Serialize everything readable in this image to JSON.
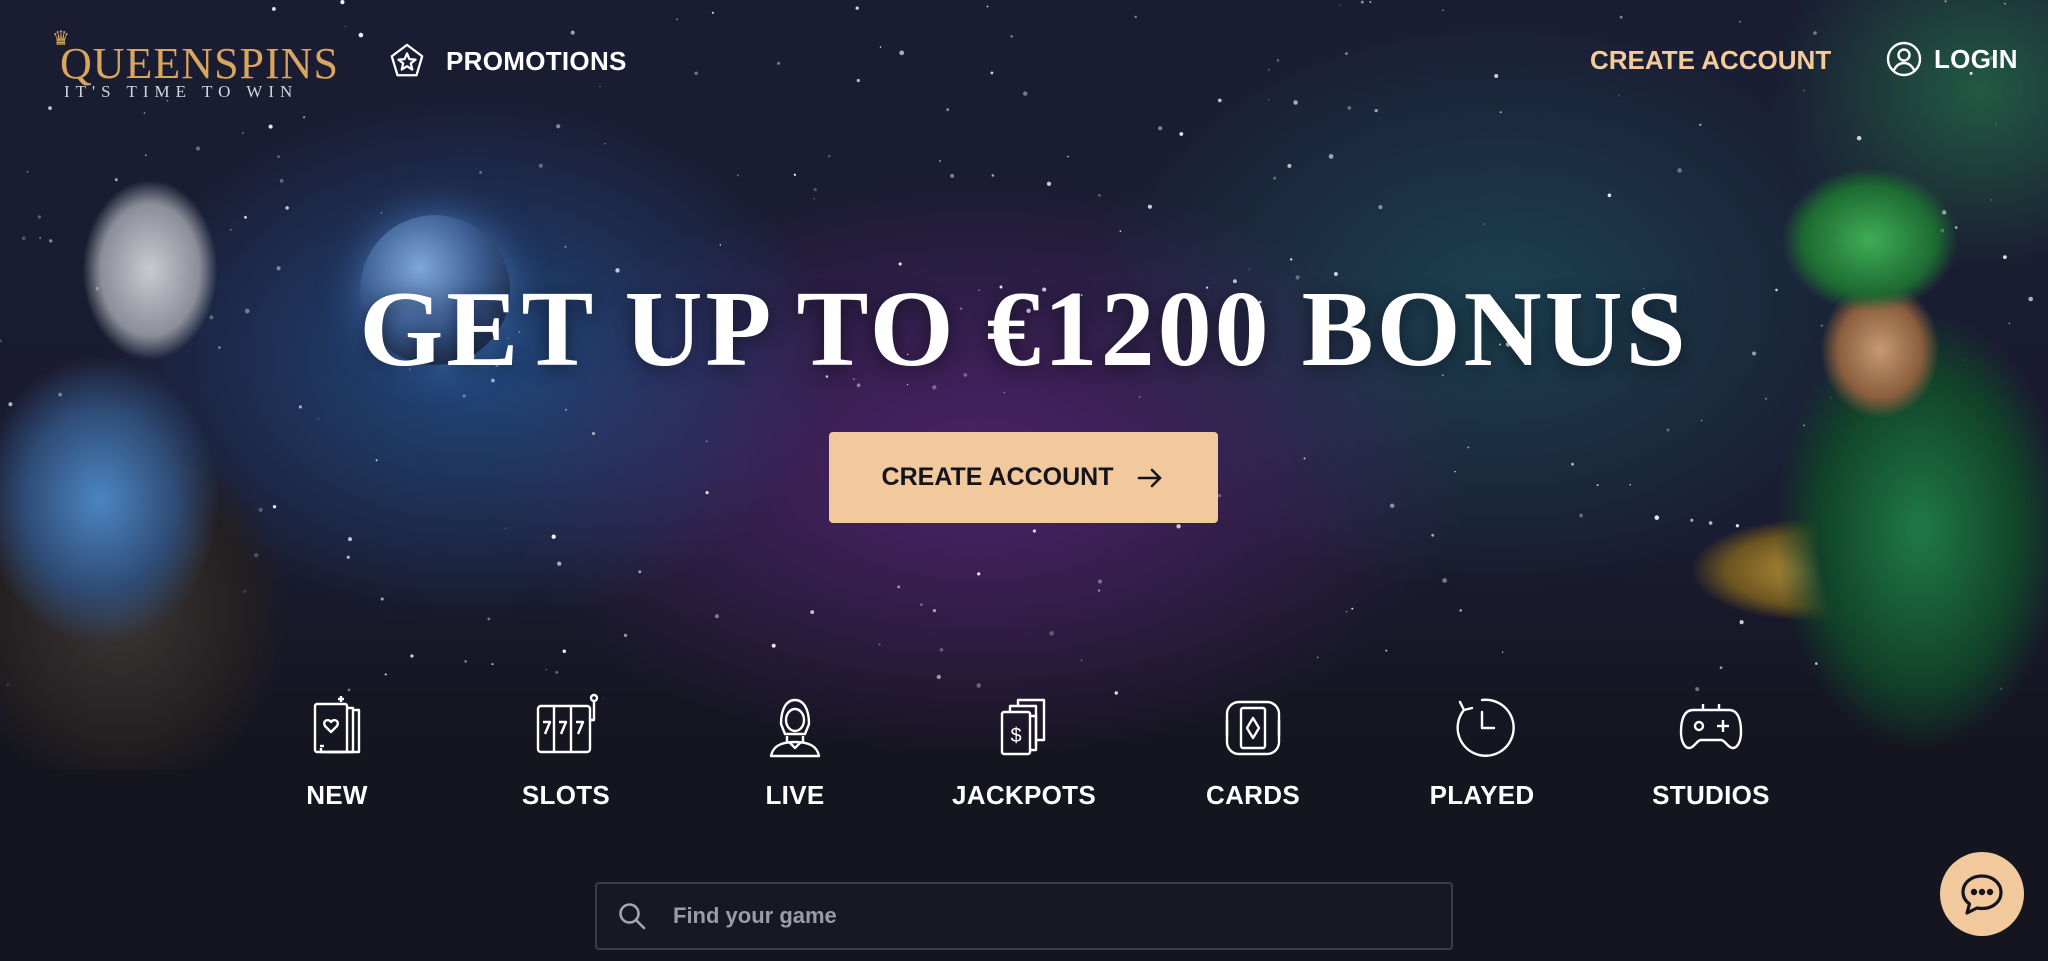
{
  "header": {
    "logo_main": "QUEENSPINS",
    "logo_tagline": "IT'S TIME TO WIN",
    "promotions_label": "PROMOTIONS",
    "create_account_label": "CREATE ACCOUNT",
    "login_label": "LOGIN"
  },
  "hero": {
    "headline": "GET UP TO €1200 BONUS",
    "cta_label": "CREATE ACCOUNT"
  },
  "categories": [
    {
      "label": "NEW",
      "icon": "new-cards-icon"
    },
    {
      "label": "SLOTS",
      "icon": "slot-machine-icon"
    },
    {
      "label": "LIVE",
      "icon": "live-dealer-icon"
    },
    {
      "label": "JACKPOTS",
      "icon": "jackpot-cards-icon"
    },
    {
      "label": "CARDS",
      "icon": "card-diamond-icon"
    },
    {
      "label": "PLAYED",
      "icon": "clock-icon"
    },
    {
      "label": "STUDIOS",
      "icon": "gamepad-icon"
    }
  ],
  "search": {
    "placeholder": "Find your game"
  },
  "colors": {
    "accent": "#f1c99d",
    "accent_text": "#f3cc9a",
    "logo_gold": "#d8a65d",
    "background": "#14151f"
  }
}
